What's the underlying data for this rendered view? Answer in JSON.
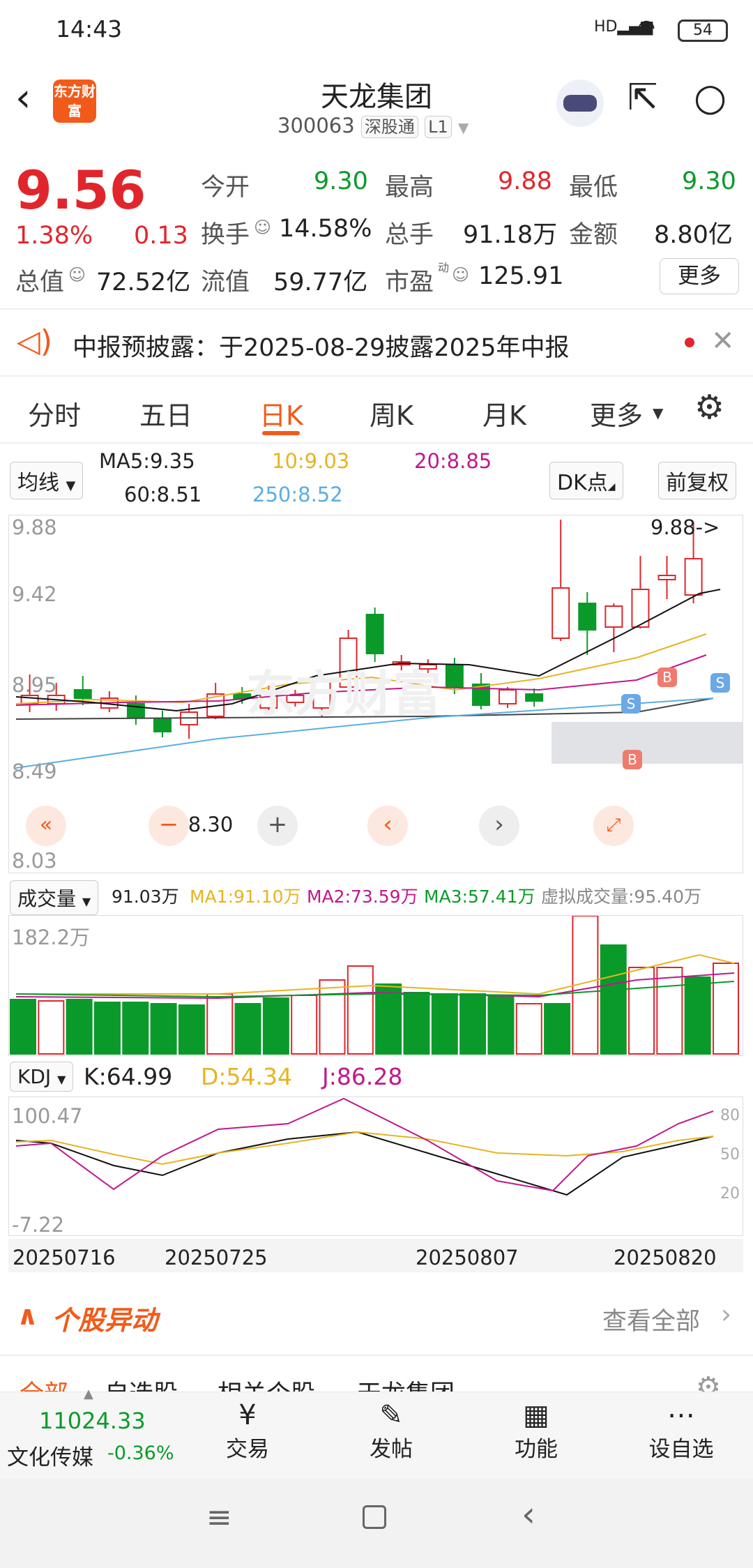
{
  "status": {
    "time": "14:43",
    "battery": "54"
  },
  "header": {
    "title": "天龙集团",
    "code": "300063",
    "tag": "深股通",
    "level": "L1",
    "logo": "东方财富"
  },
  "quote": {
    "price": "9.56",
    "pct": "1.38%",
    "chg": "0.13",
    "open_l": "今开",
    "open": "9.30",
    "high_l": "最高",
    "high": "9.88",
    "low_l": "最低",
    "low": "9.30",
    "turn_l": "换手",
    "turn": "14.58%",
    "vol_l": "总手",
    "vol": "91.18万",
    "amt_l": "金额",
    "amt": "8.80亿",
    "cap_l": "总值",
    "cap": "72.52亿",
    "float_l": "流值",
    "float": "59.77亿",
    "pe_l": "市盈",
    "pe_sup": "动",
    "pe": "125.91",
    "more": "更多"
  },
  "notice": {
    "text": "中报预披露：于2025-08-29披露2025年中报"
  },
  "tabs": [
    "分时",
    "五日",
    "日K",
    "周K",
    "月K",
    "更多"
  ],
  "ma": {
    "sel": "均线",
    "ma5": "MA5:9.35",
    "ma10": "10:9.03",
    "ma20": "20:8.85",
    "ma60": "60:8.51",
    "ma250": "250:8.52",
    "dk": "DK点",
    "fq": "前复权"
  },
  "kline": {
    "y_top": "9.88",
    "y_2": "9.42",
    "y_3": "8.95",
    "y_4": "8.49",
    "y_bot": "8.03",
    "hi_note": "9.88->",
    "lo_note": "<-8.30",
    "watermark": "东方财富"
  },
  "volbar": {
    "sel": "成交量",
    "v": "91.03万",
    "ma1": "MA1:91.10万",
    "ma2": "MA2:73.59万",
    "ma3": "MA3:57.41万",
    "virt": "虚拟成交量:95.40万",
    "top": "182.2万"
  },
  "kdj": {
    "sel": "KDJ",
    "k": "K:64.99",
    "d": "D:54.34",
    "j": "J:86.28",
    "top": "100.47",
    "bot": "-7.22",
    "l80": "80",
    "l50": "50",
    "l20": "20"
  },
  "dates": [
    "20250716",
    "20250725",
    "20250807",
    "20250820"
  ],
  "movers": {
    "title": "个股异动",
    "all": "查看全部",
    "tabs": [
      "全部",
      "自选股",
      "相关个股",
      "天龙集团"
    ]
  },
  "bottom": {
    "index_val": "11024.33",
    "index_name": "文化传媒",
    "index_pct": "-0.36%",
    "trade": "交易",
    "post": "发帖",
    "func": "功能",
    "watch": "设自选"
  },
  "colors": {
    "up": "#e0262c",
    "down": "#0a9a2a",
    "ma10": "#e6b422",
    "ma20": "#c0188c",
    "ma250": "#5aaee0",
    "accent": "#f25a1a"
  }
}
